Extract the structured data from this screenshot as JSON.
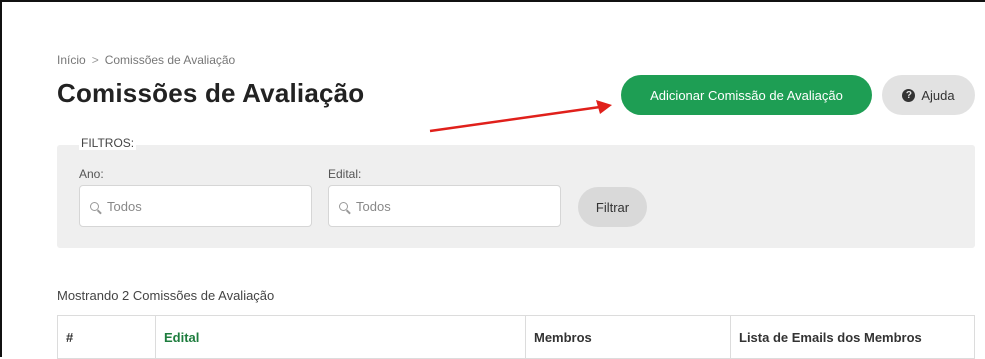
{
  "breadcrumb": {
    "home": "Início",
    "separator": ">",
    "current": "Comissões de Avaliação"
  },
  "page": {
    "title": "Comissões de Avaliação"
  },
  "actions": {
    "add_label": "Adicionar Comissão de Avaliação",
    "help_label": "Ajuda"
  },
  "filters": {
    "legend": "FILTROS:",
    "year": {
      "label": "Ano:",
      "value": "Todos"
    },
    "edital": {
      "label": "Edital:",
      "value": "Todos"
    },
    "filter_button": "Filtrar"
  },
  "results": {
    "summary": "Mostrando 2 Comissões de Avaliação"
  },
  "table": {
    "columns": [
      "#",
      "Edital",
      "Membros",
      "Lista de Emails dos Membros"
    ]
  },
  "colors": {
    "primary": "#1e9e54",
    "annotation_arrow": "#e0201b",
    "link_header": "#1e7d3e"
  }
}
